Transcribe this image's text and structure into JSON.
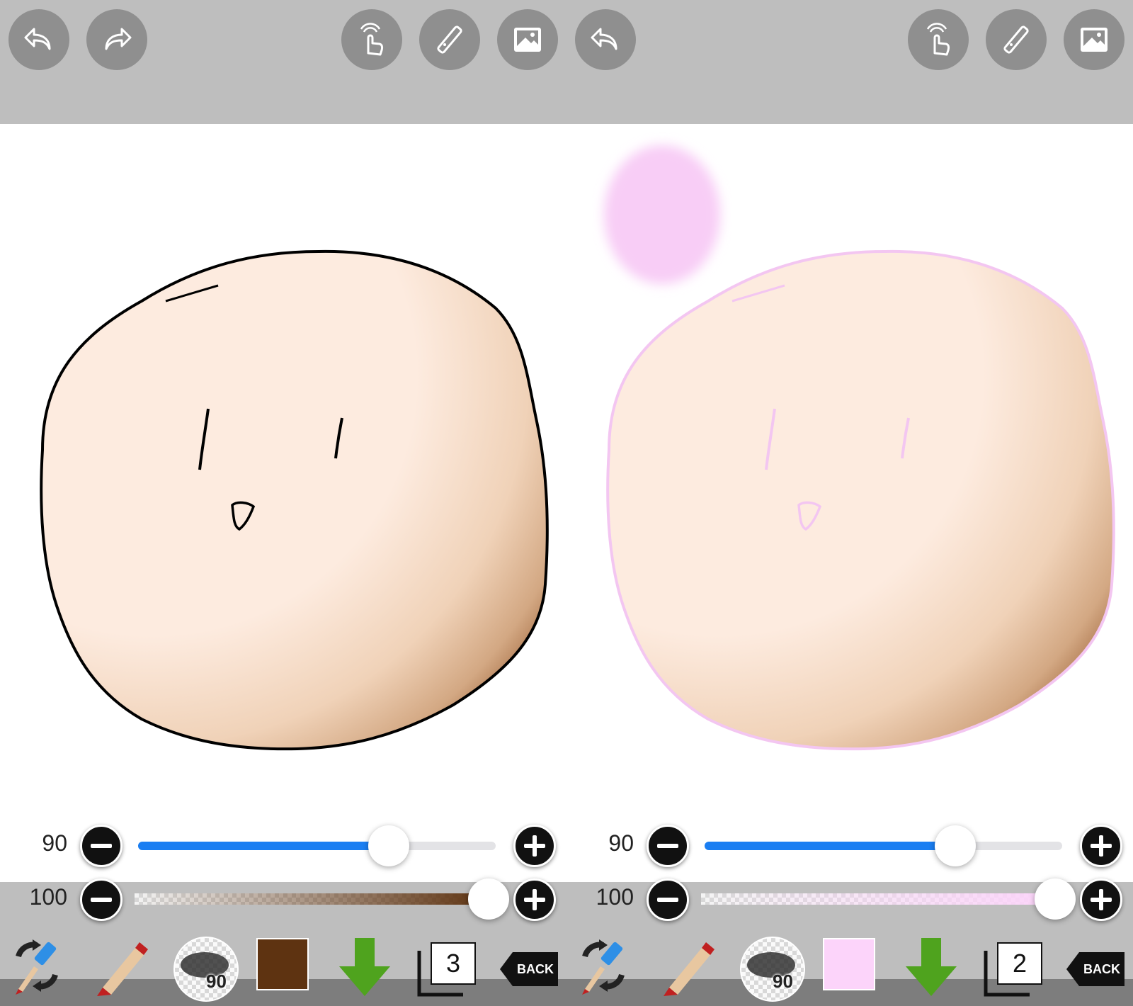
{
  "toolbar": {
    "buttons": [
      {
        "name": "undo-button",
        "icon": "undo-arrow-icon"
      },
      {
        "name": "redo-button",
        "icon": "redo-arrow-icon"
      },
      {
        "name": "touch-button",
        "icon": "hand-touch-icon"
      },
      {
        "name": "ruler-button",
        "icon": "ruler-icon"
      },
      {
        "name": "image-button",
        "icon": "image-icon"
      },
      {
        "name": "undo-button-2",
        "icon": "undo-arrow-icon"
      },
      {
        "name": "touch-button-2",
        "icon": "hand-touch-icon"
      },
      {
        "name": "ruler-button-2",
        "icon": "ruler-icon"
      },
      {
        "name": "image-button-2",
        "icon": "image-icon"
      }
    ]
  },
  "left_panel": {
    "size_value": "90",
    "opacity_value": "100",
    "size_level": 0.7,
    "opacity_level": 1.0,
    "brush_size_badge": "90",
    "color": "#5e3311",
    "layer_number": "3",
    "back_label": "BACK"
  },
  "right_panel": {
    "size_value": "90",
    "opacity_value": "100",
    "size_level": 0.7,
    "opacity_level": 1.0,
    "brush_size_badge": "90",
    "color": "#fcd4fa",
    "layer_number": "2",
    "back_label": "BACK"
  },
  "colors": {
    "topbar": "#bebebe",
    "skin": "#fde9dc",
    "shade": "#b98356",
    "outline_left": "#000000",
    "outline_right": "#f3c6f1",
    "accent_slider": "#1a7ef2"
  }
}
